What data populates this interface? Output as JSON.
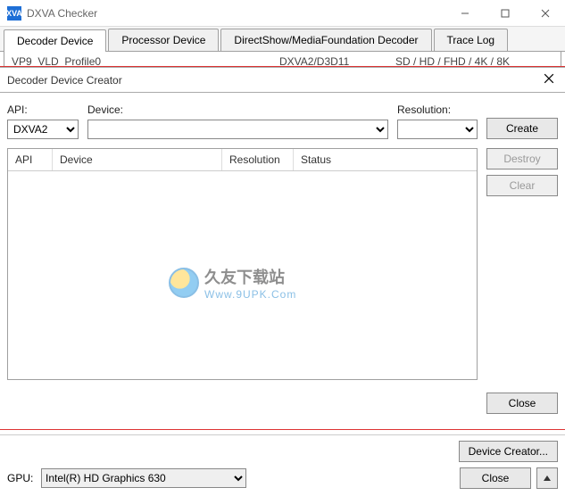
{
  "window": {
    "icon_text": "XVA",
    "title": "DXVA Checker"
  },
  "tabs": [
    {
      "label": "Decoder Device",
      "active": true
    },
    {
      "label": "Processor Device",
      "active": false
    },
    {
      "label": "DirectShow/MediaFoundation Decoder",
      "active": false
    },
    {
      "label": "Trace Log",
      "active": false
    }
  ],
  "peek_row": {
    "codec": "VP9_VLD_Profile0",
    "api": "DXVA2/D3D11",
    "res": "SD / HD / FHD / 4K / 8K"
  },
  "dialog": {
    "title": "Decoder Device Creator",
    "labels": {
      "api": "API:",
      "device": "Device:",
      "resolution": "Resolution:"
    },
    "api_value": "DXVA2",
    "device_value": "",
    "resolution_value": "",
    "buttons": {
      "create": "Create",
      "destroy": "Destroy",
      "clear": "Clear",
      "close": "Close"
    },
    "grid_headers": [
      "API",
      "Device",
      "Resolution",
      "Status"
    ]
  },
  "bottom": {
    "device_creator_btn": "Device Creator...",
    "gpu_label": "GPU:",
    "gpu_value": "Intel(R) HD Graphics 630",
    "close_btn": "Close"
  },
  "watermark": {
    "line1": "久友下载站",
    "line2": "Www.9UPK.Com"
  }
}
